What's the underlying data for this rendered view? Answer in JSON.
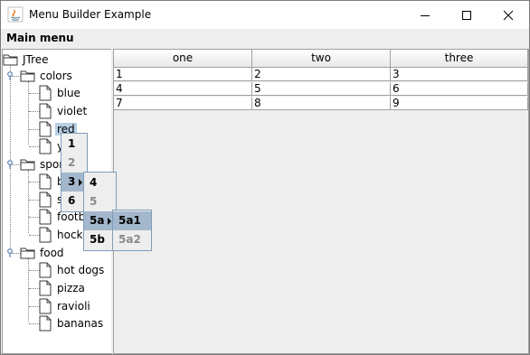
{
  "window": {
    "title": "Menu Builder Example"
  },
  "menubar": {
    "main_label": "Main menu"
  },
  "tree": {
    "root": "JTree",
    "groups": [
      {
        "label": "colors",
        "children": [
          "blue",
          "violet",
          "red",
          "yellow"
        ]
      },
      {
        "label": "sports",
        "children": [
          "basketball",
          "soccer",
          "football",
          "hockey"
        ]
      },
      {
        "label": "food",
        "children": [
          "hot dogs",
          "pizza",
          "ravioli",
          "bananas"
        ]
      }
    ],
    "visible_truncated": {
      "yellow": "y",
      "sports": "spor",
      "basketball": "b",
      "soccer": "s",
      "football": "footba",
      "hockey": "hocke"
    },
    "selected": "red"
  },
  "table": {
    "columns": [
      "one",
      "two",
      "three"
    ],
    "rows": [
      [
        "1",
        "2",
        "3"
      ],
      [
        "4",
        "5",
        "6"
      ],
      [
        "7",
        "8",
        "9"
      ]
    ]
  },
  "popup1": {
    "items": [
      {
        "label": "1",
        "enabled": true
      },
      {
        "label": "2",
        "enabled": false
      },
      {
        "label": "3",
        "enabled": true,
        "submenu": true,
        "selected": true
      },
      {
        "label": "6",
        "enabled": true
      }
    ]
  },
  "popup2": {
    "items": [
      {
        "label": "4",
        "enabled": true
      },
      {
        "label": "5",
        "enabled": false
      },
      {
        "label": "5a",
        "enabled": true,
        "submenu": true,
        "selected": true
      },
      {
        "label": "5b",
        "enabled": true
      }
    ]
  },
  "popup3": {
    "items": [
      {
        "label": "5a1",
        "enabled": true,
        "selected": true
      },
      {
        "label": "5a2",
        "enabled": false
      }
    ]
  },
  "colors": {
    "selection": "#b8cfe5",
    "menu_selection": "#a3b8cc",
    "disabled_text": "#8a8a8a"
  }
}
